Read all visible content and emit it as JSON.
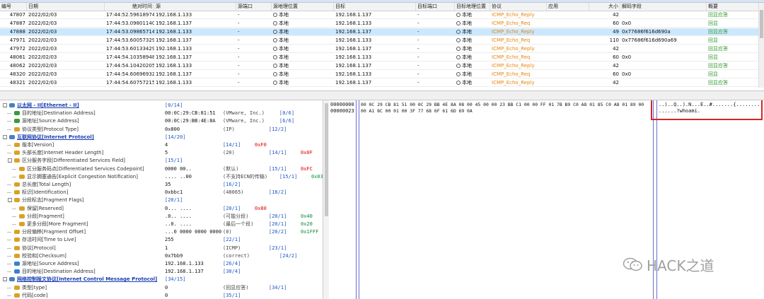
{
  "columns": [
    "编号",
    "日期",
    "绝对时间",
    "源",
    "源端口",
    "源地理位置",
    "目标",
    "目标端口",
    "目标地理位置",
    "协议",
    "应用",
    "大小",
    "解码字段",
    "概要"
  ],
  "rows": [
    {
      "no": "47807",
      "date": "2022/02/03",
      "time": "17:44:52.596189745",
      "src": "192.168.1.133",
      "sport": "-",
      "sgeo": "本地",
      "dst": "192.168.1.137",
      "dport": "-",
      "dgeo": "本地",
      "proto": "ICMP_Echo_Reply",
      "app": "",
      "size": "42",
      "decode": "",
      "summary": "回显应答"
    },
    {
      "no": "47887",
      "date": "2022/02/03",
      "time": "17:44:53.098011409",
      "src": "192.168.1.137",
      "sport": "-",
      "sgeo": "本地",
      "dst": "192.168.1.133",
      "dport": "-",
      "dgeo": "本地",
      "proto": "ICMP_Echo_Req",
      "app": "",
      "size": "60",
      "decode": "0x0",
      "summary": "回显"
    },
    {
      "no": "47888",
      "date": "2022/02/03",
      "time": "17:44:53.098657140",
      "src": "192.168.1.133",
      "sport": "-",
      "sgeo": "本地",
      "dst": "192.168.1.137",
      "dport": "-",
      "dgeo": "本地",
      "proto": "ICMP_Echo_Reply",
      "app": "",
      "size": "49",
      "decode": "0x77686f616d690a",
      "summary": "回显应答",
      "selected": true
    },
    {
      "no": "47971",
      "date": "2022/02/03",
      "time": "17:44:53.600573294",
      "src": "192.168.1.137",
      "sport": "-",
      "sgeo": "本地",
      "dst": "192.168.1.133",
      "dport": "-",
      "dgeo": "本地",
      "proto": "ICMP_Echo_Req",
      "app": "",
      "size": "110",
      "decode": "0x77686f616d690a69",
      "summary": "回显"
    },
    {
      "no": "47972",
      "date": "2022/02/03",
      "time": "17:44:53.601334294",
      "src": "192.168.1.133",
      "sport": "-",
      "sgeo": "本地",
      "dst": "192.168.1.137",
      "dport": "-",
      "dgeo": "本地",
      "proto": "ICMP_Echo_Reply",
      "app": "",
      "size": "42",
      "decode": "",
      "summary": "回显应答"
    },
    {
      "no": "48061",
      "date": "2022/02/03",
      "time": "17:44:54.103589480",
      "src": "192.168.1.137",
      "sport": "-",
      "sgeo": "本地",
      "dst": "192.168.1.133",
      "dport": "-",
      "dgeo": "本地",
      "proto": "ICMP_Echo_Req",
      "app": "",
      "size": "60",
      "decode": "0x0",
      "summary": "回显"
    },
    {
      "no": "48062",
      "date": "2022/02/03",
      "time": "17:44:54.104202056",
      "src": "192.168.1.133",
      "sport": "-",
      "sgeo": "本地",
      "dst": "192.168.1.137",
      "dport": "-",
      "dgeo": "本地",
      "proto": "ICMP_Echo_Reply",
      "app": "",
      "size": "42",
      "decode": "",
      "summary": "回显应答"
    },
    {
      "no": "48320",
      "date": "2022/02/03",
      "time": "17:44:54.606969322",
      "src": "192.168.1.137",
      "sport": "-",
      "sgeo": "本地",
      "dst": "192.168.1.133",
      "dport": "-",
      "dgeo": "本地",
      "proto": "ICMP_Echo_Req",
      "app": "",
      "size": "60",
      "decode": "0x0",
      "summary": "回显"
    },
    {
      "no": "48321",
      "date": "2022/02/03",
      "time": "17:44:54.607572157",
      "src": "192.168.1.133",
      "sport": "-",
      "sgeo": "本地",
      "dst": "192.168.1.137",
      "dport": "-",
      "dgeo": "本地",
      "proto": "ICMP_Echo_Reply",
      "app": "",
      "size": "42",
      "decode": "",
      "summary": "回显应答"
    }
  ],
  "tree": [
    {
      "indent": 0,
      "exp": "-",
      "color": "#4a7fc1",
      "name": "以太网 - II[Ethernet - II]",
      "header": true,
      "range": "[0/14]"
    },
    {
      "indent": 1,
      "color": "#3a9a3a",
      "name": "目的地址[Destination Address]",
      "value": "00:0C:29:CB:81:51",
      "note": "(VMware, Inc.)",
      "range": "[0/6]"
    },
    {
      "indent": 1,
      "color": "#3a9a3a",
      "name": "源地址[Source Address]",
      "value": "00:0C:29:BB:4E:8A",
      "note": "(VMware, Inc.)",
      "range": "[6/6]"
    },
    {
      "indent": 1,
      "color": "#d8a227",
      "name": "协议类型[Protocol Type]",
      "value": "0x800",
      "note": "(IP)",
      "range": "[12/2]"
    },
    {
      "indent": 0,
      "exp": "-",
      "color": "#4a7fc1",
      "name": "互联网协议[Internet Protocol]",
      "header": true,
      "range": "[14/20]"
    },
    {
      "indent": 1,
      "color": "#d8a227",
      "name": "版本[Version]",
      "value": "4",
      "note": "",
      "range": "[14/1]",
      "extra": "0xF0",
      "extraColor": "red"
    },
    {
      "indent": 1,
      "color": "#d8a227",
      "name": "头部长度[Internet Header Length]",
      "value": "5",
      "note": "(20)",
      "range": "[14/1]",
      "extra": "0x0F",
      "extraColor": "red"
    },
    {
      "indent": 1,
      "exp": "-",
      "color": "#d8a227",
      "name": "区分服务字段[Differentiated Services Field]",
      "value": "",
      "note": "",
      "range": "[15/1]"
    },
    {
      "indent": 2,
      "color": "#d8a227",
      "name": "区分服务码点[Differentiated Services Codepoint]",
      "value": "0000 00..",
      "note": "(默认)",
      "range": "[15/1]",
      "extra": "0xFC",
      "extraColor": "red"
    },
    {
      "indent": 2,
      "color": "#d8a227",
      "name": "显示拥塞通告[Explicit Congestion Notification]",
      "value": ".... ..00",
      "note": "(不支持ECN的传输)",
      "range": "[15/1]",
      "extra": "0x03",
      "extraColor": "grn"
    },
    {
      "indent": 1,
      "color": "#d8a227",
      "name": "总长度[Total Length]",
      "value": "35",
      "note": "",
      "range": "[16/2]"
    },
    {
      "indent": 1,
      "color": "#d8a227",
      "name": "标识[Identification]",
      "value": "0xbbc1",
      "note": "(48065)",
      "range": "[18/2]"
    },
    {
      "indent": 1,
      "exp": "-",
      "color": "#d8a227",
      "name": "分段标志[Fragment Flags]",
      "value": "",
      "note": "",
      "range": "[20/1]"
    },
    {
      "indent": 2,
      "color": "#d8a227",
      "name": "保留[Reserved]",
      "value": "0... ....",
      "note": "",
      "range": "[20/1]",
      "extra": "0x80",
      "extraColor": "red"
    },
    {
      "indent": 2,
      "color": "#d8a227",
      "name": "分段[Fragment]",
      "value": ".0.. ....",
      "note": "(可能分段)",
      "range": "[20/1]",
      "extra": "0x40",
      "extraColor": "grn"
    },
    {
      "indent": 2,
      "color": "#d8a227",
      "name": "更多分段[More Fragment]",
      "value": "..0. ....",
      "note": "(最后一个段)",
      "range": "[20/1]",
      "extra": "0x20",
      "extraColor": "grn"
    },
    {
      "indent": 1,
      "color": "#d8a227",
      "name": "分段偏移[Fragment Offset]",
      "value": "...0 0000 0000 0000",
      "note": "(0)",
      "range": "[20/2]",
      "extra": "0x1FFF",
      "extraColor": "grn"
    },
    {
      "indent": 1,
      "color": "#d8a227",
      "name": "存活时间[Time to Live]",
      "value": "255",
      "note": "",
      "range": "[22/1]"
    },
    {
      "indent": 1,
      "color": "#d8a227",
      "name": "协议[Protocol]",
      "value": "1",
      "note": "(ICMP)",
      "range": "[23/1]"
    },
    {
      "indent": 1,
      "color": "#d8a227",
      "name": "校验和[Checksum]",
      "value": "0x7bb9",
      "note": "(correct)",
      "range": "[24/2]"
    },
    {
      "indent": 1,
      "color": "#3a7fd0",
      "name": "源地址[Source Address]",
      "value": "192.168.1.133",
      "note": "",
      "range": "[26/4]"
    },
    {
      "indent": 1,
      "color": "#3a7fd0",
      "name": "目的地址[Destination Address]",
      "value": "192.168.1.137",
      "note": "",
      "range": "[30/4]"
    },
    {
      "indent": 0,
      "exp": "-",
      "color": "#4a7fc1",
      "name": "网络控制报文协议[Internet Control Message Protocol]",
      "header": true,
      "range": "[34/15]"
    },
    {
      "indent": 1,
      "color": "#d8a227",
      "name": "类型[type]",
      "value": "0",
      "note": "(回显应答)",
      "range": "[34/1]"
    },
    {
      "indent": 1,
      "color": "#d8a227",
      "name": "代码[code]",
      "value": "0",
      "note": "",
      "range": "[35/1]"
    }
  ],
  "hex": {
    "lines": [
      {
        "offset": "00000000",
        "bytes": "00 0C 29 CB 81 51 00 0C 29 BB 4E 8A 08 00 45 00 00 23 BB C1 00 00 FF 01 7B B9 C0 A8 01 85 C0 A8 01 89 00",
        "ascii": "..)..Q..).N...E..#.......{........"
      },
      {
        "offset": "00000023",
        "bytes": "00 A1 8C 00 01 00 3F 77 68 6F 61 6D 69 0A",
        "ascii": "......?whoami."
      }
    ]
  },
  "watermark": "HACK之道"
}
